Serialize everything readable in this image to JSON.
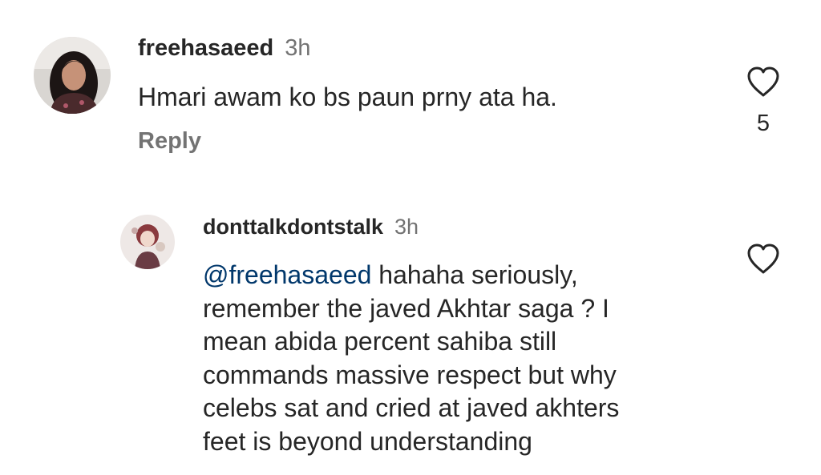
{
  "comments": [
    {
      "username": "freehasaeed",
      "timestamp": "3h",
      "text": "Hmari awam ko bs paun prny ata ha.",
      "reply_label": "Reply",
      "like_icon": "heart-outline-icon",
      "like_count": "5"
    },
    {
      "username": "donttalkdontstalk",
      "timestamp": "3h",
      "mention": "@freehasaeed",
      "text_lines": [
        " hahaha seriously,",
        "remember the javed Akhtar saga ? I",
        "mean abida percent sahiba still",
        "commands massive respect but why",
        "celebs sat and cried at javed akhters",
        "feet is beyond understanding"
      ],
      "like_icon": "heart-outline-icon"
    }
  ],
  "colors": {
    "text": "#262626",
    "secondary": "#737373",
    "mention": "#00376b"
  }
}
